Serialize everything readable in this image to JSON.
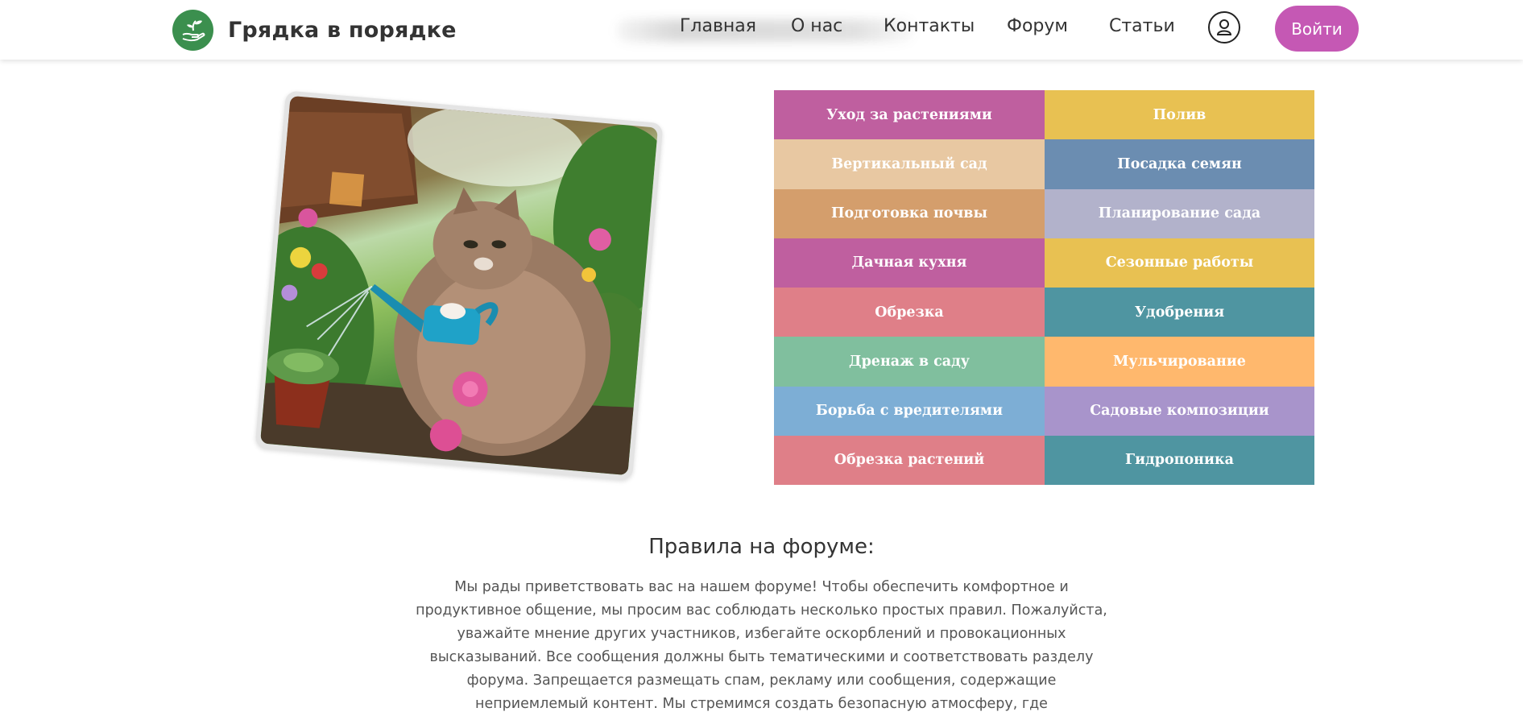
{
  "header": {
    "site_title": "Грядка в порядке",
    "logo_icon": "plant-in-hand-icon",
    "nav": [
      {
        "label": "Главная"
      },
      {
        "label": "О нас"
      },
      {
        "label": "Контакты"
      },
      {
        "label": "Форум"
      },
      {
        "label": "Статьи"
      }
    ],
    "user_icon": "user-icon",
    "login_label": "Войти",
    "login_color": "#c558b4"
  },
  "hero_image": {
    "icon": "cat-watering-flowers-photo"
  },
  "categories": [
    {
      "label": "Уход за растениями",
      "color": "#bf5f9f"
    },
    {
      "label": "Полив",
      "color": "#e8c152"
    },
    {
      "label": "Вертикальный сад",
      "color": "#e8c8a2"
    },
    {
      "label": "Посадка семян",
      "color": "#6b8db1"
    },
    {
      "label": "Подготовка почвы",
      "color": "#d49e6c"
    },
    {
      "label": "Планирование сада",
      "color": "#b2b2cb"
    },
    {
      "label": "Дачная кухня",
      "color": "#bf5f9f"
    },
    {
      "label": "Сезонные работы",
      "color": "#e8c152"
    },
    {
      "label": "Обрезка",
      "color": "#df7f88"
    },
    {
      "label": "Удобрения",
      "color": "#4f95a1"
    },
    {
      "label": "Дренаж в саду",
      "color": "#80bf9e"
    },
    {
      "label": "Мульчирование",
      "color": "#ffb86d"
    },
    {
      "label": "Борьба с вредителями",
      "color": "#7daed5"
    },
    {
      "label": "Садовые композиции",
      "color": "#a894cb"
    },
    {
      "label": "Обрезка растений",
      "color": "#df7f88"
    },
    {
      "label": "Гидропоника",
      "color": "#4f95a1"
    }
  ],
  "rules": {
    "title": "Правила на форуме:",
    "text": "Мы рады приветствовать вас на нашем форуме! Чтобы обеспечить комфортное и продуктивное общение, мы просим вас соблюдать несколько простых правил. Пожалуйста, уважайте мнение других участников, избегайте оскорблений и провокационных высказываний. Все сообщения должны быть тематическими и соответствовать разделу форума. Запрещается размещать спам, рекламу или сообщения, содержащие неприемлемый контент. Мы стремимся создать безопасную атмосферу, где"
  }
}
